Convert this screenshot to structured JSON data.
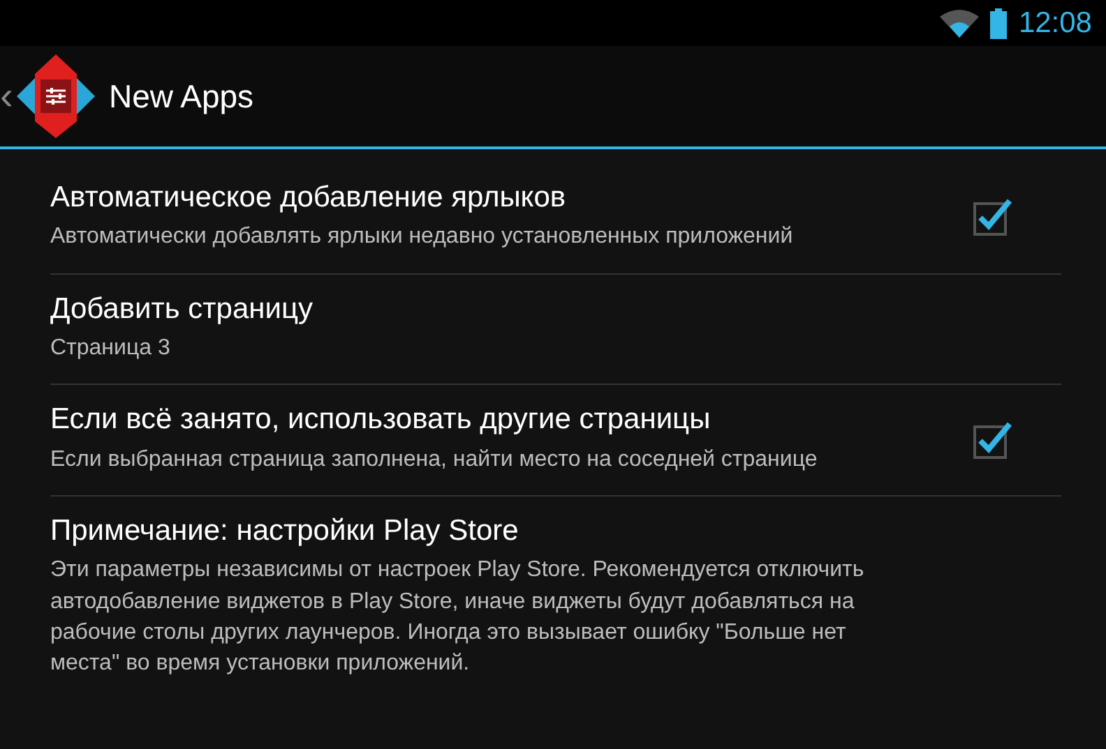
{
  "status_bar": {
    "time": "12:08"
  },
  "action_bar": {
    "back": "‹",
    "title": "New Apps"
  },
  "settings": [
    {
      "kind": "checkbox",
      "title": "Автоматическое добавление ярлыков",
      "summary": "Автоматически добавлять ярлыки недавно установленных приложений",
      "checked": true
    },
    {
      "kind": "plain",
      "title": "Добавить страницу",
      "summary": "Страница 3"
    },
    {
      "kind": "checkbox",
      "title": "Если всё занято, использовать другие страницы",
      "summary": "Если выбранная страница заполнена, найти место на соседней странице",
      "checked": true
    },
    {
      "kind": "plain",
      "title": "Примечание: настройки Play Store",
      "summary": "Эти параметры независимы от настроек Play Store. Рекомендуется отключить автодобавление виджетов в Play Store, иначе виджеты будут добавляться на рабочие столы других лаунчеров. Иногда это вызывает ошибку \"Больше нет места\" во время установки приложений."
    }
  ]
}
